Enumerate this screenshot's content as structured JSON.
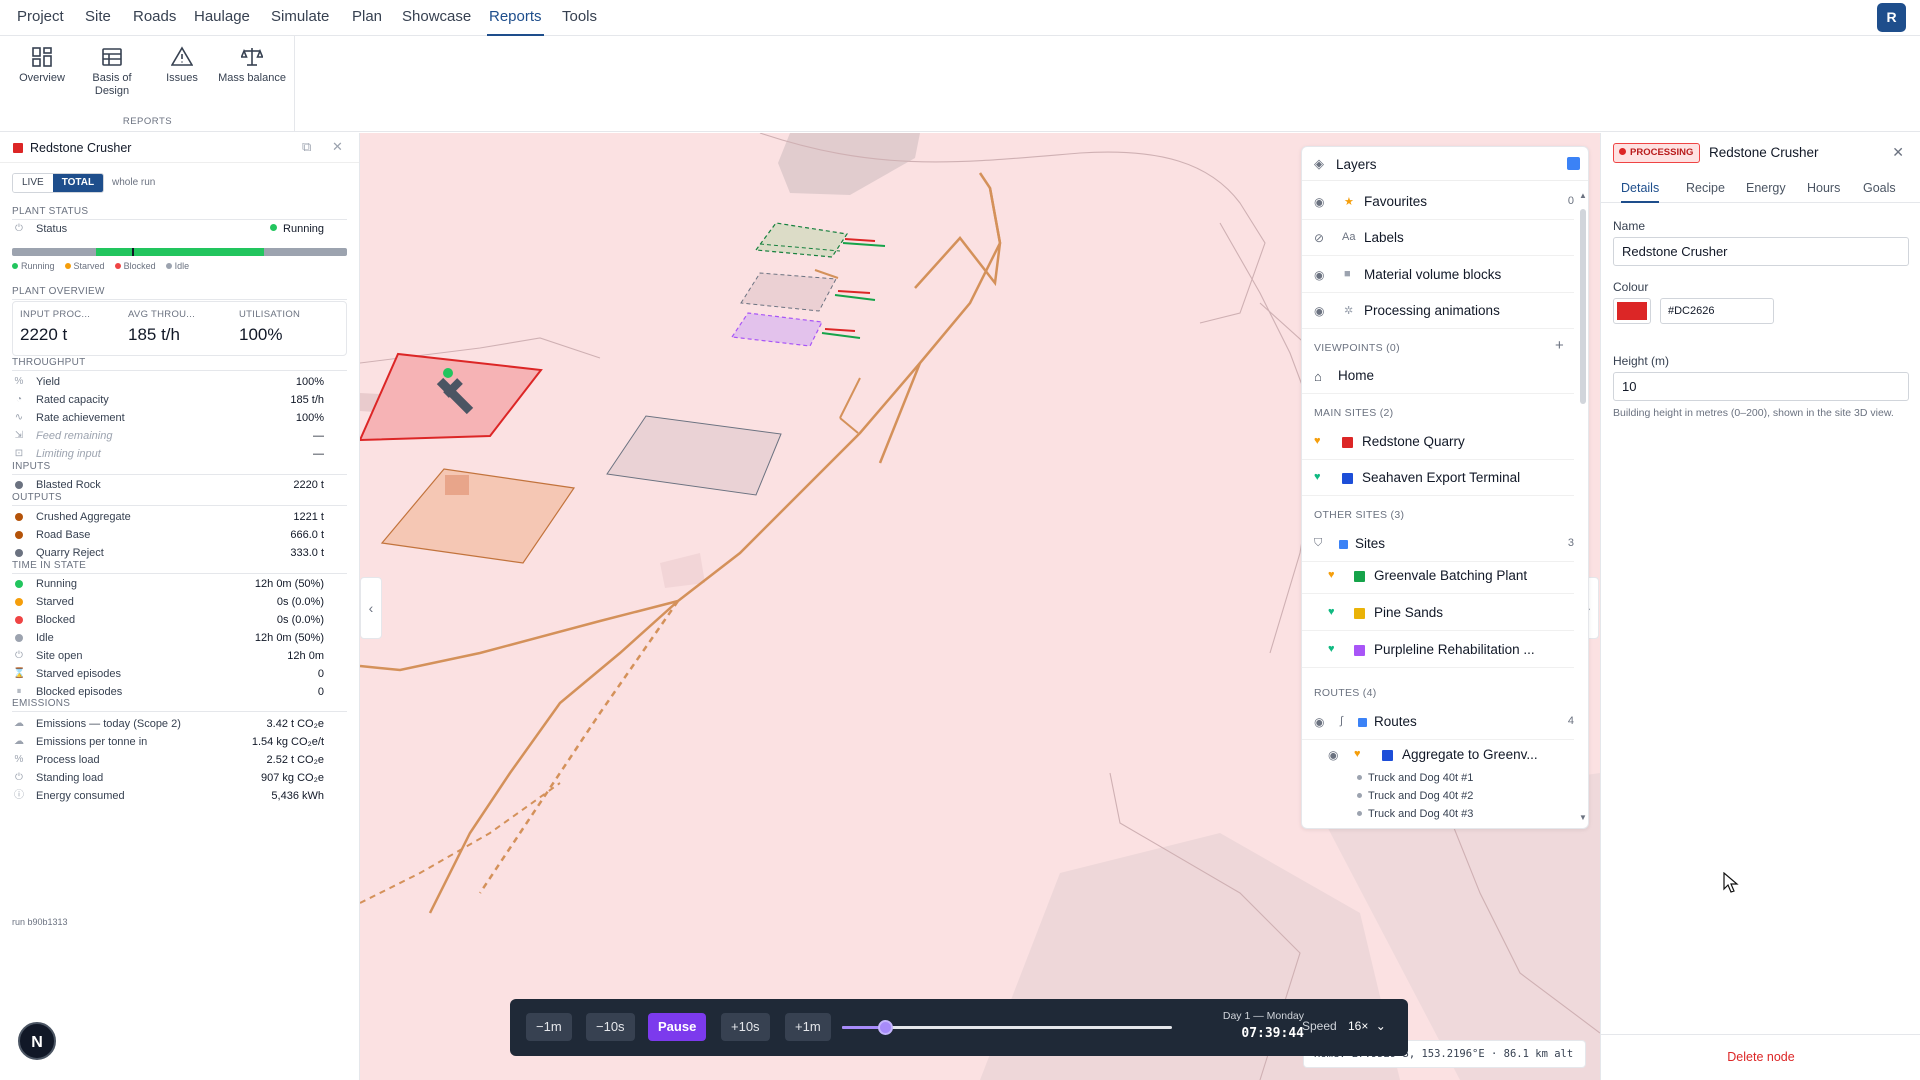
{
  "menu": [
    "Project",
    "Site",
    "Roads",
    "Haulage",
    "Simulate",
    "Plan",
    "Showcase",
    "Reports",
    "Tools"
  ],
  "menu_active": "Reports",
  "user_initial": "R",
  "ribbon": {
    "group_label": "REPORTS",
    "buttons": [
      {
        "label": "Overview",
        "icon": "dashboard-icon"
      },
      {
        "label": "Basis of Design",
        "icon": "table-icon"
      },
      {
        "label": "Issues",
        "icon": "warning-icon"
      },
      {
        "label": "Mass balance",
        "icon": "scale-icon"
      }
    ]
  },
  "left_panel": {
    "title": "Redstone Crusher",
    "modes": [
      "LIVE",
      "TOTAL"
    ],
    "active_mode": "TOTAL",
    "mode_note": "whole run",
    "plant_status_heading": "PLANT STATUS",
    "status_label": "Status",
    "status_value": "Running",
    "legend": [
      "Running",
      "Starved",
      "Blocked",
      "Idle"
    ],
    "overview_heading": "PLANT OVERVIEW",
    "kpis": [
      {
        "label": "INPUT PROC...",
        "value": "2220 t"
      },
      {
        "label": "AVG THROU...",
        "value": "185 t/h"
      },
      {
        "label": "UTILISATION",
        "value": "100%"
      }
    ],
    "throughput_heading": "THROUGHPUT",
    "throughput": [
      {
        "label": "Yield",
        "value": "100%"
      },
      {
        "label": "Rated capacity",
        "value": "185 t/h"
      },
      {
        "label": "Rate achievement",
        "value": "100%"
      },
      {
        "label": "Feed remaining",
        "value": "—"
      },
      {
        "label": "Limiting input",
        "value": "—"
      }
    ],
    "inputs_heading": "INPUTS",
    "inputs": [
      {
        "label": "Blasted Rock",
        "value": "2220 t",
        "color": "#6b7280"
      }
    ],
    "outputs_heading": "OUTPUTS",
    "outputs": [
      {
        "label": "Crushed Aggregate",
        "value": "1221 t",
        "color": "#b45309"
      },
      {
        "label": "Road Base",
        "value": "666.0 t",
        "color": "#b45309"
      },
      {
        "label": "Quarry Reject",
        "value": "333.0 t",
        "color": "#6b7280"
      }
    ],
    "time_heading": "TIME IN STATE",
    "time_in_state": [
      {
        "label": "Running",
        "value": "12h 0m (50%)",
        "color": "#22c55e"
      },
      {
        "label": "Starved",
        "value": "0s (0.0%)",
        "color": "#f59e0b"
      },
      {
        "label": "Blocked",
        "value": "0s (0.0%)",
        "color": "#ef4444"
      },
      {
        "label": "Idle",
        "value": "12h 0m (50%)",
        "color": "#9ca3af"
      },
      {
        "label": "Site open",
        "value": "12h 0m"
      },
      {
        "label": "Starved episodes",
        "value": "0"
      },
      {
        "label": "Blocked episodes",
        "value": "0"
      }
    ],
    "emissions_heading": "EMISSIONS",
    "emissions": [
      {
        "label": "Emissions — today (Scope 2)",
        "value": "3.42 t CO₂e"
      },
      {
        "label": "Emissions per tonne in",
        "value": "1.54 kg CO₂e/t"
      },
      {
        "label": "Process load",
        "value": "2.52 t CO₂e"
      },
      {
        "label": "Standing load",
        "value": "907 kg CO₂e"
      },
      {
        "label": "Energy consumed",
        "value": "5,436 kWh"
      }
    ],
    "run_id": "run b90b1313"
  },
  "layers": {
    "title": "Layers",
    "favourites": {
      "label": "Favourites",
      "count": "0"
    },
    "labels": "Labels",
    "material_blocks": "Material volume blocks",
    "processing_anims": "Processing animations",
    "viewpoints_heading": "VIEWPOINTS (0)",
    "home": "Home",
    "main_sites_heading": "MAIN SITES (2)",
    "main_sites": [
      {
        "label": "Redstone Quarry",
        "color": "#dc2626",
        "heart": "#f59e0b"
      },
      {
        "label": "Seahaven Export Terminal",
        "color": "#1d4ed8",
        "heart": "#10b981"
      }
    ],
    "other_sites_heading": "OTHER SITES (3)",
    "sites_group": {
      "label": "Sites",
      "count": "3"
    },
    "other_sites": [
      {
        "label": "Greenvale Batching Plant",
        "color": "#16a34a",
        "heart": "#f59e0b"
      },
      {
        "label": "Pine Sands",
        "color": "#eab308",
        "heart": "#10b981"
      },
      {
        "label": "Purpleline Rehabilitation ...",
        "color": "#a855f7",
        "heart": "#10b981"
      }
    ],
    "routes_heading": "ROUTES (4)",
    "routes_group": {
      "label": "Routes",
      "count": "4"
    },
    "route": {
      "label": "Aggregate to Greenv...",
      "color": "#1d4ed8",
      "heart": "#f59e0b"
    },
    "vehicles": [
      "Truck and Dog 40t #1",
      "Truck and Dog 40t #2",
      "Truck and Dog 40t #3"
    ]
  },
  "playback": {
    "buttons": [
      "−1m",
      "−10s",
      "Pause",
      "+10s",
      "+1m"
    ],
    "progress": 0.13,
    "day": "Day 1 — Monday",
    "time": "07:39:44",
    "speed_label": "Speed",
    "speed": "16×"
  },
  "coord_readout": "Home: 27.9529°S, 153.2196°E · 86.1 km alt",
  "right_panel": {
    "badge": "PROCESSING",
    "title": "Redstone Crusher",
    "tabs": [
      "Details",
      "Recipe",
      "Energy",
      "Hours",
      "Goals"
    ],
    "active_tab": "Details",
    "name_label": "Name",
    "name_value": "Redstone Crusher",
    "colour_label": "Colour",
    "colour_value": "#DC2626",
    "height_label": "Height (m)",
    "height_value": "10",
    "height_help": "Building height in metres (0–200), shown in the site 3D view.",
    "delete": "Delete node"
  },
  "dev_badge": "N"
}
